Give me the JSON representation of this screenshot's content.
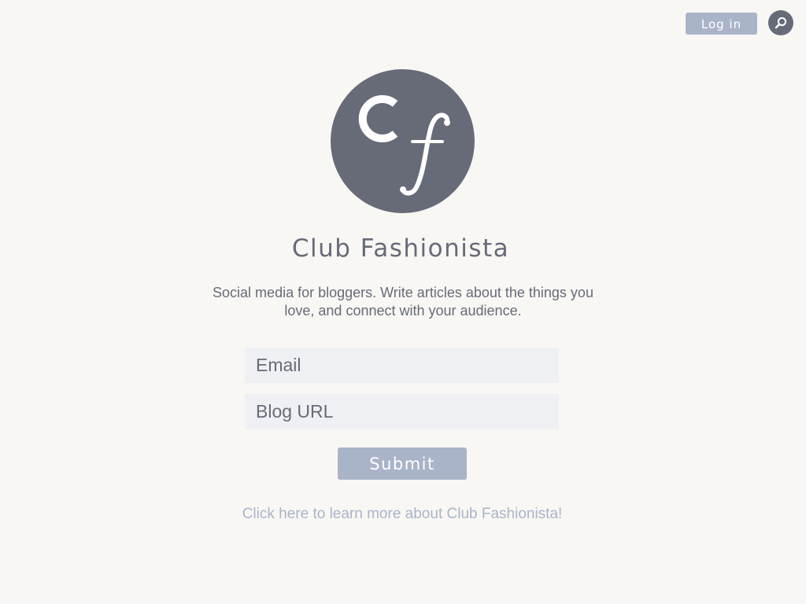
{
  "header": {
    "login_label": "Log in",
    "search_icon": "search-icon"
  },
  "logo": {
    "letters": "Cf",
    "background_color": "#676b77"
  },
  "hero": {
    "title": "Club Fashionista",
    "tagline": "Social media for bloggers. Write articles about the things you love, and connect with your audience."
  },
  "form": {
    "email_placeholder": "Email",
    "email_value": "",
    "blog_url_placeholder": "Blog URL",
    "blog_url_value": "",
    "submit_label": "Submit"
  },
  "footer": {
    "learn_more_label": "Click here to learn more about Club Fashionista!"
  },
  "colors": {
    "background": "#f8f7f4",
    "text": "#676b77",
    "accent": "#aab4c8",
    "field": "#eff0f4"
  }
}
